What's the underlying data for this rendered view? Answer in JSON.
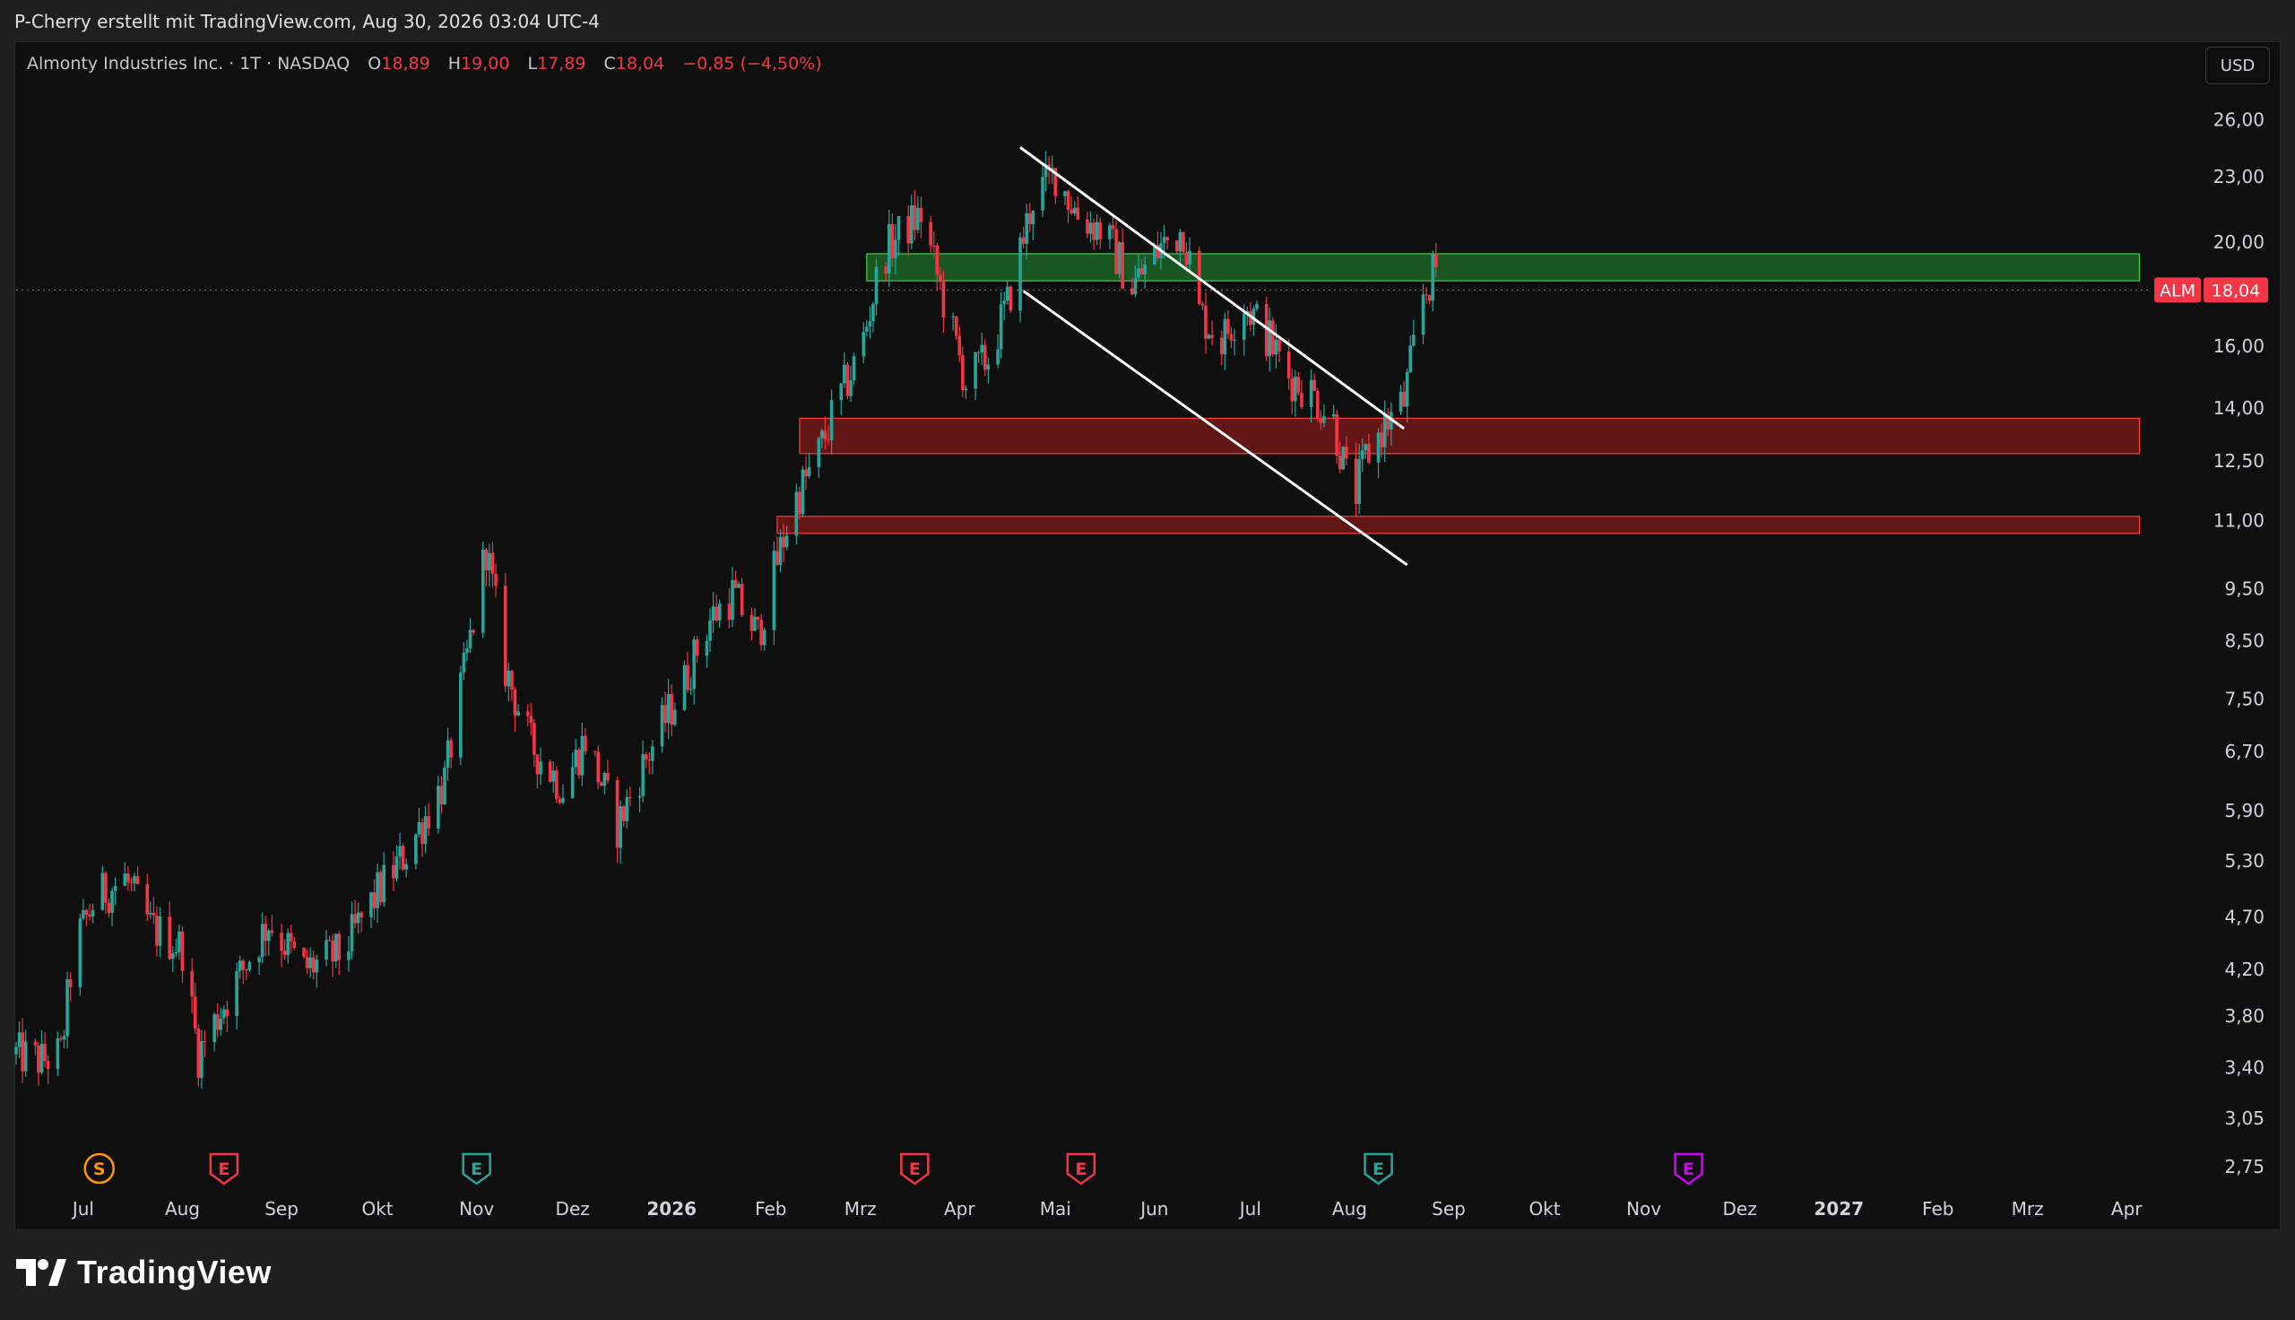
{
  "header": {
    "caption": "P-Cherry erstellt mit TradingView.com, Aug 30, 2026 03:04 UTC-4"
  },
  "legend": {
    "symbol": "Almonty Industries Inc. · 1T · NASDAQ",
    "open_label": "O",
    "open": "18,89",
    "high_label": "H",
    "high": "19,00",
    "low_label": "L",
    "low": "17,89",
    "close_label": "C",
    "close": "18,04",
    "change": "−0,85 (−4,50%)"
  },
  "toolbar": {
    "currency": "USD"
  },
  "footer": {
    "brand": "TradingView"
  },
  "colors": {
    "up": "#26a69a",
    "down": "#f23645",
    "support_zone": "#7f1a1a",
    "resistance_zone": "#1f6f2a",
    "trendline": "#ffffff",
    "background": "#0f0f0f"
  },
  "chart_data": {
    "type": "candlestick",
    "interval": "1T",
    "y_scale": "log",
    "ylim": [
      2.6,
      28
    ],
    "xlim": [
      "2025-06-10",
      "2027-04-20"
    ],
    "y_ticks": [
      2.75,
      3.05,
      3.4,
      3.8,
      4.2,
      4.7,
      5.3,
      5.9,
      6.7,
      7.5,
      8.5,
      9.5,
      11.0,
      12.5,
      14.0,
      16.0,
      20.0,
      23.0,
      26.0
    ],
    "y_tick_labels": [
      "2,75",
      "3,05",
      "3,40",
      "3,80",
      "4,20",
      "4,70",
      "5,30",
      "5,90",
      "6,70",
      "7,50",
      "8,50",
      "9,50",
      "11,00",
      "12,50",
      "14,00",
      "16,00",
      "20,00",
      "23,00",
      "26,00"
    ],
    "x_ticks": [
      {
        "label": "Jul",
        "date": "2025-07-01",
        "bold": false
      },
      {
        "label": "Aug",
        "date": "2025-08-01",
        "bold": false
      },
      {
        "label": "Sep",
        "date": "2025-09-01",
        "bold": false
      },
      {
        "label": "Okt",
        "date": "2025-10-01",
        "bold": false
      },
      {
        "label": "Nov",
        "date": "2025-11-01",
        "bold": false
      },
      {
        "label": "Dez",
        "date": "2025-12-01",
        "bold": false
      },
      {
        "label": "2026",
        "date": "2026-01-01",
        "bold": true
      },
      {
        "label": "Feb",
        "date": "2026-02-01",
        "bold": false
      },
      {
        "label": "Mrz",
        "date": "2026-03-01",
        "bold": false
      },
      {
        "label": "Apr",
        "date": "2026-04-01",
        "bold": false
      },
      {
        "label": "Mai",
        "date": "2026-05-01",
        "bold": false
      },
      {
        "label": "Jun",
        "date": "2026-06-01",
        "bold": false
      },
      {
        "label": "Jul",
        "date": "2026-07-01",
        "bold": false
      },
      {
        "label": "Aug",
        "date": "2026-08-01",
        "bold": false
      },
      {
        "label": "Sep",
        "date": "2026-09-01",
        "bold": false
      },
      {
        "label": "Okt",
        "date": "2026-10-01",
        "bold": false
      },
      {
        "label": "Nov",
        "date": "2026-11-01",
        "bold": false
      },
      {
        "label": "Dez",
        "date": "2026-12-01",
        "bold": false
      },
      {
        "label": "2027",
        "date": "2027-01-01",
        "bold": true
      },
      {
        "label": "Feb",
        "date": "2027-02-01",
        "bold": false
      },
      {
        "label": "Mrz",
        "date": "2027-03-01",
        "bold": false
      },
      {
        "label": "Apr",
        "date": "2027-04-01",
        "bold": false
      }
    ],
    "price_path": [
      [
        "2025-06-10",
        3.5
      ],
      [
        "2025-06-18",
        3.45
      ],
      [
        "2025-06-24",
        3.5
      ],
      [
        "2025-06-28",
        4.4
      ],
      [
        "2025-07-05",
        4.9
      ],
      [
        "2025-07-14",
        5.1
      ],
      [
        "2025-07-22",
        4.6
      ],
      [
        "2025-08-01",
        4.4
      ],
      [
        "2025-08-06",
        3.5
      ],
      [
        "2025-08-14",
        3.9
      ],
      [
        "2025-08-28",
        4.65
      ],
      [
        "2025-09-08",
        4.2
      ],
      [
        "2025-09-20",
        4.35
      ],
      [
        "2025-10-01",
        4.95
      ],
      [
        "2025-10-10",
        5.4
      ],
      [
        "2025-10-22",
        6.3
      ],
      [
        "2025-11-01",
        9.2
      ],
      [
        "2025-11-04",
        10.4
      ],
      [
        "2025-11-10",
        8.0
      ],
      [
        "2025-11-18",
        6.8
      ],
      [
        "2025-11-28",
        6.2
      ],
      [
        "2025-12-05",
        6.9
      ],
      [
        "2025-12-15",
        5.7
      ],
      [
        "2025-12-24",
        6.6
      ],
      [
        "2026-01-05",
        7.8
      ],
      [
        "2026-01-13",
        8.9
      ],
      [
        "2026-01-20",
        9.4
      ],
      [
        "2026-01-28",
        8.6
      ],
      [
        "2026-02-01",
        9.6
      ],
      [
        "2026-02-08",
        11.4
      ],
      [
        "2026-02-15",
        12.5
      ],
      [
        "2026-02-22",
        14.2
      ],
      [
        "2026-03-01",
        15.8
      ],
      [
        "2026-03-08",
        19.5
      ],
      [
        "2026-03-15",
        20.6
      ],
      [
        "2026-03-20",
        21.2
      ],
      [
        "2026-03-28",
        17.2
      ],
      [
        "2026-04-03",
        14.8
      ],
      [
        "2026-04-10",
        15.6
      ],
      [
        "2026-04-16",
        17.5
      ],
      [
        "2026-04-24",
        22.0
      ],
      [
        "2026-05-01",
        23.2
      ],
      [
        "2026-05-08",
        21.2
      ],
      [
        "2026-05-16",
        20.5
      ],
      [
        "2026-05-25",
        18.2
      ],
      [
        "2026-06-03",
        19.8
      ],
      [
        "2026-06-10",
        20.6
      ],
      [
        "2026-06-15",
        17.2
      ],
      [
        "2026-06-22",
        16.2
      ],
      [
        "2026-06-29",
        17.6
      ],
      [
        "2026-07-06",
        16.4
      ],
      [
        "2026-07-13",
        15.0
      ],
      [
        "2026-07-20",
        14.5
      ],
      [
        "2026-07-27",
        13.6
      ],
      [
        "2026-08-02",
        11.4
      ],
      [
        "2026-08-06",
        12.6
      ],
      [
        "2026-08-12",
        13.5
      ],
      [
        "2026-08-18",
        14.2
      ],
      [
        "2026-08-24",
        17.8
      ],
      [
        "2026-08-28",
        18.9
      ],
      [
        "2026-08-30",
        18.04
      ]
    ],
    "last_price": {
      "symbol": "ALM",
      "value": 18.04,
      "label": "18,04"
    },
    "zones": [
      {
        "kind": "resistance",
        "from": "2026-03-03",
        "to": "2027-04-05",
        "low": 18.4,
        "high": 19.5
      },
      {
        "kind": "support",
        "from": "2026-02-10",
        "to": "2027-04-05",
        "low": 12.7,
        "high": 13.7
      },
      {
        "kind": "support",
        "from": "2026-02-03",
        "to": "2027-04-05",
        "low": 10.7,
        "high": 11.1
      }
    ],
    "trendlines": [
      {
        "from": [
          "2026-04-20",
          24.5
        ],
        "to": [
          "2026-08-18",
          13.4
        ]
      },
      {
        "from": [
          "2026-04-21",
          18.0
        ],
        "to": [
          "2026-08-19",
          10.0
        ]
      }
    ],
    "events": [
      {
        "letter": "S",
        "kind": "split",
        "date": "2025-07-06"
      },
      {
        "letter": "E",
        "kind": "earnings-past-miss",
        "date": "2025-08-14"
      },
      {
        "letter": "E",
        "kind": "earnings-past-beat",
        "date": "2025-11-01"
      },
      {
        "letter": "E",
        "kind": "earnings-past-miss",
        "date": "2026-03-18"
      },
      {
        "letter": "E",
        "kind": "earnings-past-miss",
        "date": "2026-05-09"
      },
      {
        "letter": "E",
        "kind": "earnings-past-beat",
        "date": "2026-08-10"
      },
      {
        "letter": "E",
        "kind": "earnings-upcoming",
        "date": "2026-11-15"
      }
    ]
  }
}
